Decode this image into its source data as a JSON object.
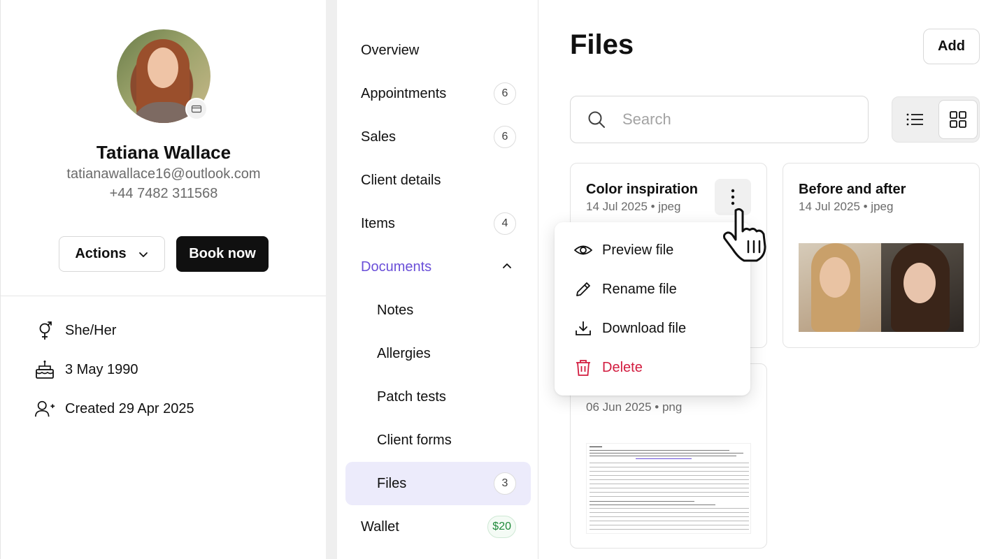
{
  "profile": {
    "name": "Tatiana Wallace",
    "email": "tatianawallace16@outlook.com",
    "phone": "+44 7482 311568",
    "actions_label": "Actions",
    "book_label": "Book now",
    "pronouns": "She/Her",
    "birthday": "3 May 1990",
    "created": "Created 29 Apr 2025"
  },
  "nav": {
    "items": [
      {
        "label": "Overview"
      },
      {
        "label": "Appointments",
        "count": "6"
      },
      {
        "label": "Sales",
        "count": "6"
      },
      {
        "label": "Client details"
      },
      {
        "label": "Items",
        "count": "4"
      },
      {
        "label": "Documents"
      },
      {
        "label": "Notes"
      },
      {
        "label": "Allergies"
      },
      {
        "label": "Patch tests"
      },
      {
        "label": "Client forms"
      },
      {
        "label": "Files",
        "count": "3"
      },
      {
        "label": "Wallet",
        "count": "$20"
      }
    ]
  },
  "main": {
    "title": "Files",
    "add_label": "Add",
    "search_placeholder": "Search",
    "files": [
      {
        "name": "Color inspiration",
        "meta": "14 Jul 2025 • jpeg"
      },
      {
        "name": "Before and after",
        "meta": "14 Jul 2025 • jpeg"
      },
      {
        "name": "",
        "meta": "06 Jun 2025 • png"
      }
    ]
  },
  "menu": {
    "preview": "Preview file",
    "rename": "Rename file",
    "download": "Download file",
    "delete": "Delete"
  },
  "colors": {
    "accent": "#6a4fd8",
    "selected_bg": "#ecebfb",
    "danger": "#d21c3f",
    "primary_button": "#101010",
    "wallet_green": "#1f8a3a"
  }
}
